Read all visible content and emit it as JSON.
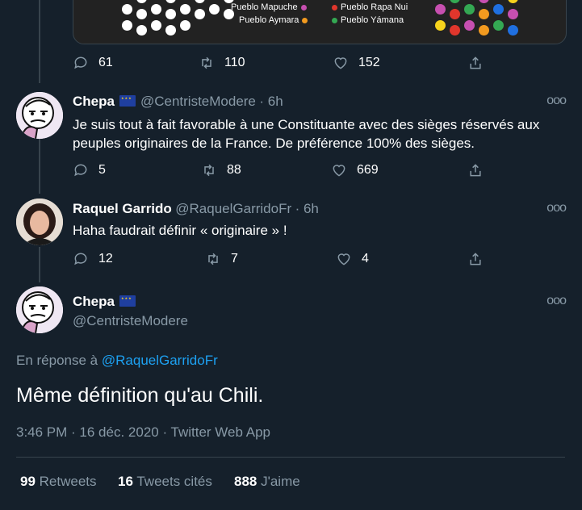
{
  "top_tweet": {
    "legend": [
      {
        "label": "Pueblo Mapuche",
        "color": "#c74fb0"
      },
      {
        "label": "Pueblo Aymara",
        "color": "#f29a1f"
      },
      {
        "label": "Pueblo Rapa Nui",
        "color": "#e0362c"
      },
      {
        "label": "Pueblo Yámana",
        "color": "#34a853"
      }
    ],
    "replies": "61",
    "retweets": "110",
    "likes": "152"
  },
  "tweet1": {
    "name": "Chepa",
    "handle": "@CentristeModere",
    "time": "· 6h",
    "text": "Je suis tout à fait favorable à une Constituante avec des sièges réservés aux peuples originaires de la France. De préférence 100% des sièges.",
    "replies": "5",
    "retweets": "88",
    "likes": "669"
  },
  "tweet2": {
    "name": "Raquel Garrido",
    "handle": "@RaquelGarridoFr",
    "time": "· 6h",
    "text": "Haha faudrait définir « originaire » !",
    "replies": "12",
    "retweets": "7",
    "likes": "4"
  },
  "main_tweet": {
    "name": "Chepa",
    "handle": "@CentristeModere",
    "reply_prefix": "En réponse à",
    "reply_to": "@RaquelGarridoFr",
    "text": "Même définition qu'au Chili.",
    "meta": "3:46 PM · 16 déc. 2020 · Twitter Web App",
    "retweets_count": "99",
    "retweets_label": "Retweets",
    "quotes_count": "16",
    "quotes_label": "Tweets cités",
    "likes_count": "888",
    "likes_label": "J'aime"
  },
  "more_label": "ooo"
}
